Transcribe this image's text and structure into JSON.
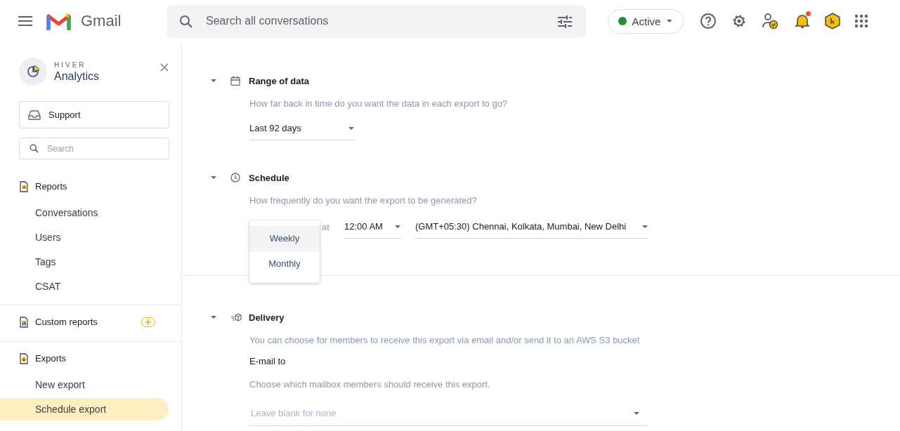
{
  "header": {
    "app_name": "Gmail",
    "search": {
      "placeholder": "Search all conversations"
    },
    "status": {
      "label": "Active",
      "color": "#1e8e3e"
    },
    "notifications": {
      "unread": true
    }
  },
  "sidebar": {
    "brand": {
      "overline": "HIVER",
      "title": "Analytics"
    },
    "inbox": {
      "label": "Support"
    },
    "search": {
      "placeholder": "Search"
    },
    "groups": [
      {
        "kind": "reports",
        "label": "Reports",
        "addable": false,
        "items": [
          {
            "label": "Conversations",
            "selected": false
          },
          {
            "label": "Users",
            "selected": false
          },
          {
            "label": "Tags",
            "selected": false
          },
          {
            "label": "CSAT",
            "selected": false
          }
        ]
      },
      {
        "kind": "custom",
        "label": "Custom reports",
        "addable": true
      },
      {
        "kind": "exports",
        "label": "Exports",
        "addable": false,
        "items": [
          {
            "label": "New export",
            "selected": false
          },
          {
            "label": "Schedule export",
            "selected": true
          }
        ]
      }
    ]
  },
  "sections": [
    {
      "kind": "range",
      "title": "Range of data",
      "expanded": true,
      "description": "How far back in time do you want the data in each export to go?",
      "select": {
        "value": "Last 92 days"
      }
    },
    {
      "kind": "schedule",
      "title": "Schedule",
      "expanded": true,
      "description": "How frequently do you want the export to be generated?",
      "connector": "at",
      "time": {
        "value": "12:00 AM"
      },
      "timezone": {
        "value": "(GMT+05:30) Chennai, Kolkata, Mumbai, New Delhi"
      },
      "menu": {
        "options": [
          {
            "label": "Weekly",
            "selected": true
          },
          {
            "label": "Monthly",
            "selected": false
          }
        ]
      }
    },
    {
      "kind": "delivery",
      "title": "Delivery",
      "expanded": true,
      "description": "You can choose for members to receive this export via email and/or send it to an AWS S3 bucket",
      "label": "E-mail to",
      "hint": "Choose which mailbox members should receive this export.",
      "field": {
        "placeholder": "Leave blank for none"
      }
    }
  ]
}
